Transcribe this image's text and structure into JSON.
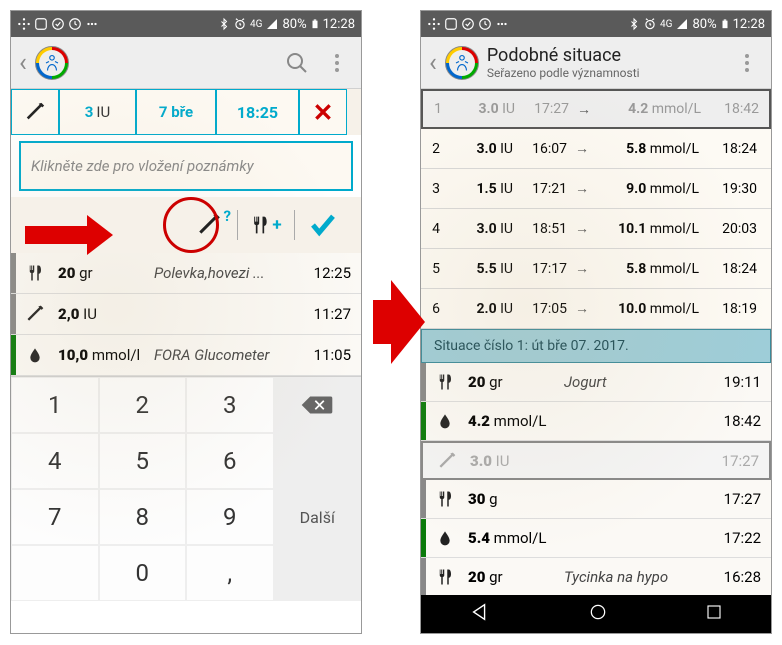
{
  "status": {
    "time": "12:28",
    "battery": "80%",
    "signal": "4G"
  },
  "left": {
    "entry": {
      "value": "3",
      "unit": "IU",
      "date": "7 bře",
      "time": "18:25"
    },
    "note_placeholder": "Klikněte zde pro vložení poznámky",
    "log": [
      {
        "icon": "food",
        "stripe": "gray",
        "value": "20",
        "unit": "gr",
        "desc": "Polevka,hovezi ...",
        "time": "12:25"
      },
      {
        "icon": "syringe",
        "stripe": "gray",
        "value": "2,0",
        "unit": "IU",
        "desc": "",
        "time": "11:27"
      },
      {
        "icon": "drop",
        "stripe": "green",
        "value": "10,0",
        "unit": "mmol/l",
        "desc": "FORA Glucometer",
        "time": "11:05"
      }
    ],
    "keypad": {
      "keys": [
        "1",
        "2",
        "3",
        "bksp",
        "4",
        "5",
        "6",
        "Další",
        "7",
        "8",
        "9",
        "",
        "",
        "0",
        ",",
        ""
      ],
      "next_label": "Další"
    }
  },
  "right": {
    "title": "Podobné situace",
    "subtitle": "Seřazeno podle významnosti",
    "rows": [
      {
        "idx": "1",
        "dose": "3.0",
        "du": "IU",
        "t1": "17:27",
        "gl": "4.2",
        "gu": "mmol/L",
        "t2": "18:42",
        "selected": true
      },
      {
        "idx": "2",
        "dose": "3.0",
        "du": "IU",
        "t1": "16:07",
        "gl": "5.8",
        "gu": "mmol/L",
        "t2": "18:24"
      },
      {
        "idx": "3",
        "dose": "1.5",
        "du": "IU",
        "t1": "17:21",
        "gl": "9.0",
        "gu": "mmol/L",
        "t2": "19:30"
      },
      {
        "idx": "4",
        "dose": "3.0",
        "du": "IU",
        "t1": "18:51",
        "gl": "10.1",
        "gu": "mmol/L",
        "t2": "20:03"
      },
      {
        "idx": "5",
        "dose": "5.5",
        "du": "IU",
        "t1": "17:17",
        "gl": "5.8",
        "gu": "mmol/L",
        "t2": "18:24"
      },
      {
        "idx": "6",
        "dose": "2.0",
        "du": "IU",
        "t1": "17:05",
        "gl": "10.0",
        "gu": "mmol/L",
        "t2": "18:19"
      }
    ],
    "banner": "Situace číslo 1: út bře 07. 2017.",
    "detail": [
      {
        "icon": "food",
        "stripe": "gray",
        "value": "20",
        "unit": "gr",
        "desc": "Jogurt",
        "time": "19:11"
      },
      {
        "icon": "drop",
        "stripe": "green",
        "value": "4.2",
        "unit": "mmol/L",
        "desc": "",
        "time": "18:42"
      },
      {
        "icon": "syringe",
        "stripe": "none",
        "value": "3.0",
        "unit": "IU",
        "desc": "",
        "time": "17:27",
        "faded": true
      },
      {
        "icon": "food",
        "stripe": "gray",
        "value": "30",
        "unit": "g",
        "desc": "",
        "time": "17:27"
      },
      {
        "icon": "drop",
        "stripe": "green",
        "value": "5.4",
        "unit": "mmol/L",
        "desc": "",
        "time": "17:22"
      },
      {
        "icon": "food",
        "stripe": "gray",
        "value": "20",
        "unit": "gr",
        "desc": "Tycinka na hypo",
        "time": "16:28"
      }
    ]
  }
}
